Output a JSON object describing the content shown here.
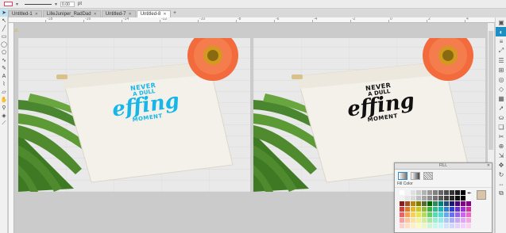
{
  "toolbar": {
    "stroke_value": "0.00",
    "stroke_unit": "pt",
    "fill_color": "#ffffff",
    "stroke_color": "#dd4466"
  },
  "tabs": [
    {
      "label": "Untitled-1",
      "active": false
    },
    {
      "label": "LilleJuniper_RadDad",
      "active": false
    },
    {
      "label": "Untitled-7",
      "active": false
    },
    {
      "label": "Untitled-8",
      "active": true
    }
  ],
  "ruler": {
    "labels": [
      "-18",
      "-16",
      "-14",
      "-12",
      "-10",
      "-8",
      "-6",
      "-4",
      "-2",
      "0",
      "2",
      "4"
    ]
  },
  "left_tools": [
    "select-arrow-icon",
    "node-edit-icon",
    "line-icon",
    "rectangle-icon",
    "ellipse-icon",
    "polygon-icon",
    "curve-icon",
    "pen-icon",
    "text-icon",
    "knife-icon",
    "eraser-icon",
    "pan-icon",
    "zoom-icon",
    "fill-bucket-icon",
    "eyedropper-icon",
    "ruler-icon",
    "crop-icon",
    "trace-icon"
  ],
  "right_tools": [
    "page-setup-icon",
    "fill-icon",
    "line-style-icon",
    "transform-icon",
    "align-icon",
    "replicate-icon",
    "offset-icon",
    "trace-panel-icon",
    "library-icon",
    "send-icon",
    "store-icon",
    "layers-icon",
    "modify-icon",
    "weld-icon",
    "scale-icon",
    "move-icon",
    "rotate-icon",
    "mirror-icon",
    "group-icon"
  ],
  "designs": {
    "left": {
      "line1": "NEVER",
      "line2": "A DULL",
      "line3": "effing",
      "line4": "MOMENT",
      "color": "#16b7e8"
    },
    "right": {
      "line1": "NEVER",
      "line2": "A DULL",
      "line3": "effing",
      "line4": "MOMENT",
      "color": "#111111"
    }
  },
  "fill_panel": {
    "title": "FILL",
    "section_label": "Fill Color",
    "selected_color": "#d9c5a6",
    "palette": [
      [
        "#ffffff",
        "#f2f2f2",
        "#e0e0e0",
        "#cccccc",
        "#b3b3b3",
        "#999999",
        "#808080",
        "#666666",
        "#4d4d4d",
        "#333333",
        "#1a1a1a",
        "#000000",
        "#ffffff"
      ],
      [
        "#f2f2f2",
        "#e6e6e6",
        "#d9d9d9",
        "#bfbfbf",
        "#a6a6a6",
        "#8c8c8c",
        "#737373",
        "#595959",
        "#404040",
        "#262626",
        "#0d0d0d",
        "#000000",
        "#f8f8f8"
      ],
      [
        "#8b1d1d",
        "#a0522d",
        "#b8860b",
        "#808000",
        "#556b2f",
        "#006400",
        "#2e8b57",
        "#008080",
        "#1f4e79",
        "#191970",
        "#4b0082",
        "#800080",
        "#8b008b"
      ],
      [
        "#d93a3a",
        "#e07b2a",
        "#e8b923",
        "#c8c81e",
        "#8fbf2f",
        "#3cb043",
        "#2fbf8f",
        "#1fb5b5",
        "#2d7fd8",
        "#2f3fd8",
        "#6a2fd8",
        "#a32fd8",
        "#d82fa3"
      ],
      [
        "#f06060",
        "#f5a055",
        "#f5d055",
        "#e6e655",
        "#b4dc55",
        "#66cc66",
        "#55dcb4",
        "#55d5d5",
        "#66a8f0",
        "#6670f0",
        "#9666f0",
        "#c866f0",
        "#f066c8"
      ],
      [
        "#f8a0a0",
        "#fac59a",
        "#fae49a",
        "#f2f29a",
        "#d6ee9a",
        "#a6e6a6",
        "#9aeed6",
        "#9ae9e9",
        "#a6cbf8",
        "#a6aef8",
        "#c6a6f8",
        "#e2a6f8",
        "#f8a6e2"
      ],
      [
        "#fcd0d0",
        "#fde0c8",
        "#fdf0c8",
        "#fafac8",
        "#ecf8c8",
        "#d2f4d2",
        "#c8f8ec",
        "#c8f6f6",
        "#d2e4fc",
        "#d2d6fc",
        "#e2d2fc",
        "#f0d2fc",
        "#fcd2f0"
      ]
    ]
  }
}
